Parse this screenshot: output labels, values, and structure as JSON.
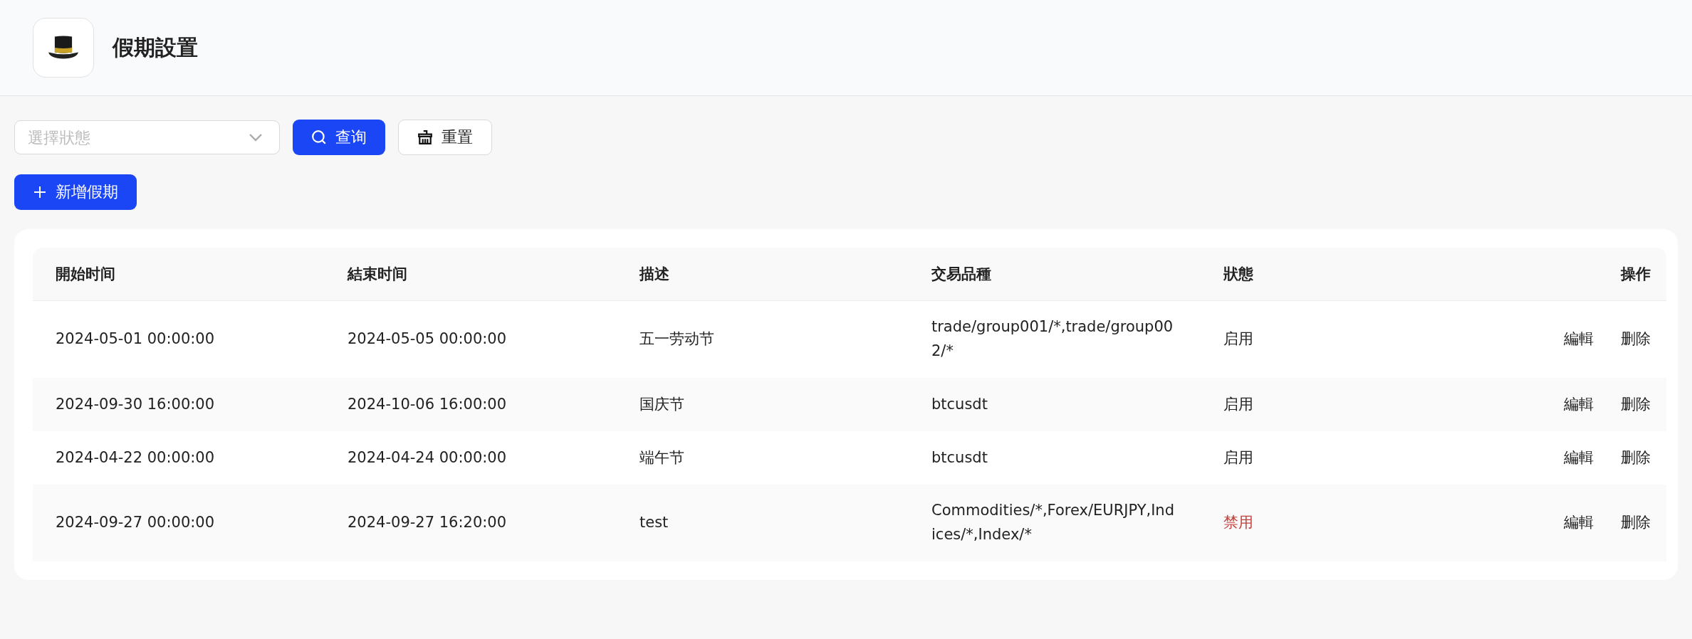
{
  "header": {
    "title": "假期設置"
  },
  "filters": {
    "status_select": {
      "placeholder": "選擇狀態"
    },
    "query_button": "查询",
    "reset_button": "重置"
  },
  "add_button": "新增假期",
  "table": {
    "columns": [
      "開始时间",
      "結束时间",
      "描述",
      "交易品種",
      "狀態",
      "操作"
    ],
    "rows": [
      {
        "start": "2024-05-01 00:00:00",
        "end": "2024-05-05 00:00:00",
        "description": "五一劳动节",
        "symbols": "trade/group001/*,trade/group002/*",
        "status": "启用",
        "enabled": true,
        "actions": [
          "編輯",
          "删除"
        ]
      },
      {
        "start": "2024-09-30 16:00:00",
        "end": "2024-10-06 16:00:00",
        "description": "国庆节",
        "symbols": "btcusdt",
        "status": "启用",
        "enabled": true,
        "actions": [
          "編輯",
          "删除"
        ]
      },
      {
        "start": "2024-04-22 00:00:00",
        "end": "2024-04-24 00:00:00",
        "description": "端午节",
        "symbols": "btcusdt",
        "status": "启用",
        "enabled": true,
        "actions": [
          "編輯",
          "删除"
        ]
      },
      {
        "start": "2024-09-27 00:00:00",
        "end": "2024-09-27 16:20:00",
        "description": "test",
        "symbols": "Commodities/*,Forex/EURJPY,Indices/*,Index/*",
        "status": "禁用",
        "enabled": false,
        "actions": [
          "編輯",
          "删除"
        ]
      }
    ]
  }
}
